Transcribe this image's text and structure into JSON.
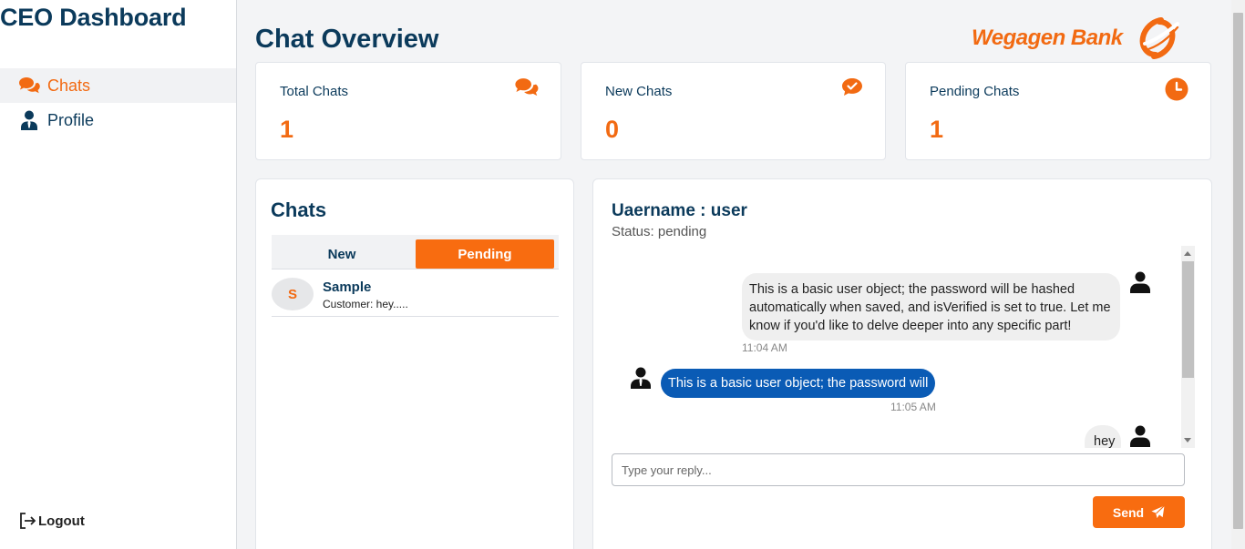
{
  "sidebar": {
    "brand": "CEO Dashboard",
    "items": [
      {
        "label": "Chats",
        "icon": "comments-icon",
        "active": true
      },
      {
        "label": "Profile",
        "icon": "user-tie-icon",
        "active": false
      }
    ],
    "logout_label": "Logout"
  },
  "header": {
    "title": "Chat Overview",
    "logo_text": "Wegagen Bank"
  },
  "stats": [
    {
      "label": "Total Chats",
      "value": "1",
      "icon": "comments-icon"
    },
    {
      "label": "New Chats",
      "value": "0",
      "icon": "comment-check-icon"
    },
    {
      "label": "Pending Chats",
      "value": "1",
      "icon": "clock-icon"
    }
  ],
  "chats": {
    "title": "Chats",
    "tabs": [
      {
        "label": "New",
        "active": false
      },
      {
        "label": "Pending",
        "active": true
      }
    ],
    "list": [
      {
        "initial": "S",
        "name": "Sample",
        "preview": "Customer: hey....."
      }
    ]
  },
  "conversation": {
    "username_line": "Uaername : user",
    "status_line": "Status: pending",
    "messages": [
      {
        "from": "customer",
        "text": "This is a basic user object; the password will be hashed automatically when saved, and isVerified is set to true. Let me know if you'd like to delve deeper into any specific part!",
        "time": "11:04 AM"
      },
      {
        "from": "agent",
        "text": "This is a basic user object; the password will",
        "time": "11:05 AM"
      },
      {
        "from": "customer",
        "text": "hey",
        "time": ""
      }
    ],
    "reply_placeholder": "Type your reply...",
    "send_label": "Send"
  },
  "colors": {
    "accent": "#f86c10",
    "primary": "#0b3a5b",
    "agent_bubble": "#0a5bb5",
    "customer_bubble": "#efefef"
  }
}
